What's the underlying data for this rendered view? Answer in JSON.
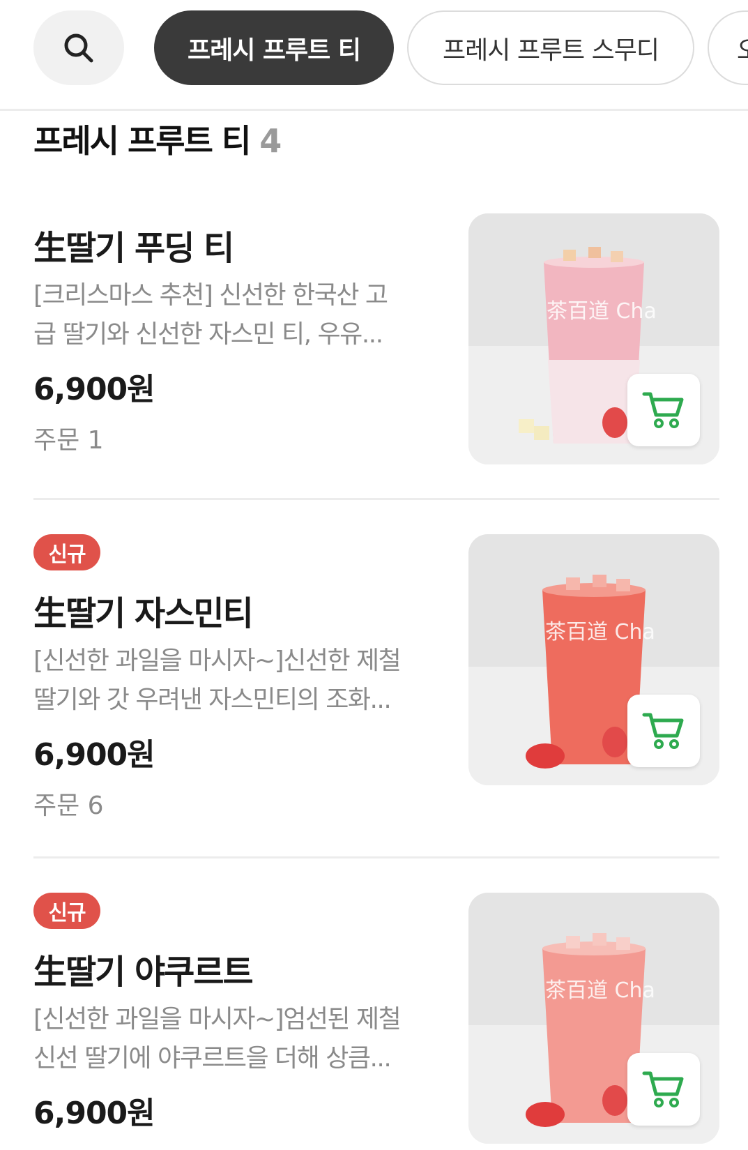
{
  "top_nav": {
    "chips": [
      {
        "label": "프레시 프루트 티"
      },
      {
        "label": "프레시 프루트 스무디"
      },
      {
        "label": "오"
      }
    ]
  },
  "section": {
    "title": "프레시 프루트 티",
    "count": "4"
  },
  "items": [
    {
      "name": "生딸기 푸딩 티",
      "badge": "",
      "desc_line1": "[크리스마스 추천] 신선한 한국산 고",
      "desc_line2": "급 딸기와 신선한 자스민 티, 우유...",
      "price": "6,900원",
      "orders": "주문 1",
      "image_text": "茶百道 Cha"
    },
    {
      "name": "生딸기 자스민티",
      "badge": "신규",
      "desc_line1": "[신선한 과일을 마시자~]신선한 제철",
      "desc_line2": "딸기와 갓 우려낸 자스민티의 조화...",
      "price": "6,900원",
      "orders": "주문 6",
      "image_text": "茶百道 Cha"
    },
    {
      "name": "生딸기 야쿠르트",
      "badge": "신규",
      "desc_line1": "[신선한 과일을 마시자~]엄선된 제철",
      "desc_line2": "신선 딸기에 야쿠르트을 더해 상큼...",
      "price": "6,900원",
      "orders": "",
      "image_text": "茶百道 Cha"
    }
  ],
  "colors": {
    "active_chip": "#3a3a3a",
    "badge": "#e0524a",
    "cart_icon": "#2eaa4f",
    "muted_text": "#8a8a8a"
  }
}
